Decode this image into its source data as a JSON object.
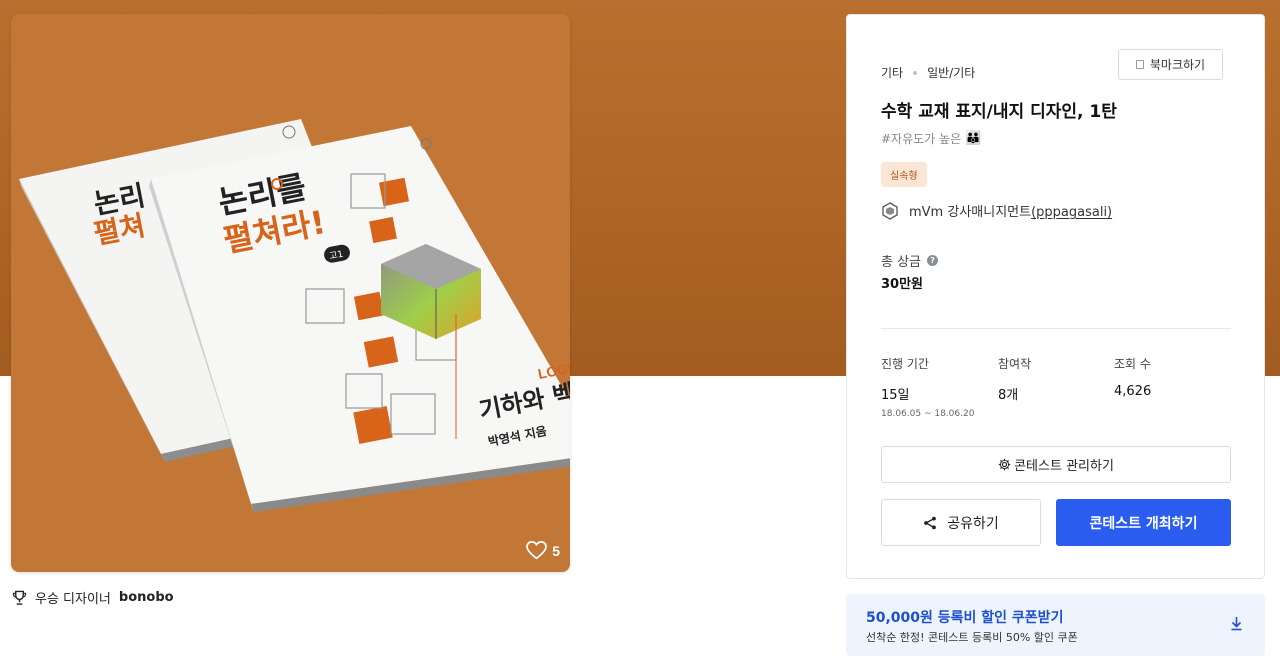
{
  "cover": {
    "like_count": "5",
    "book_front": {
      "title_line1": "논리를",
      "title_line2": "펼쳐라!",
      "grade_badge": "고1",
      "subject": "기하와 벡터",
      "series": "LOGIC",
      "author": "박영석 지음"
    },
    "book_back": {
      "title_line1": "논리",
      "title_line2": "펼쳐"
    }
  },
  "winner": {
    "label": "우승 디자이너",
    "name": "bonobo"
  },
  "panel": {
    "breadcrumb": [
      "기타",
      "일반/기타"
    ],
    "bookmark_label": "북마크하기",
    "title": "수학 교재 표지/내지 디자인, 1탄",
    "hashtag": "#자유도가 높은",
    "hashtag_emoji": "👪",
    "type_badge": "실속형",
    "host_name": "mVm 강사매니지먼트",
    "host_id": "(pppagasali)",
    "prize_label": "총 상금",
    "prize_value": "30만원",
    "stats": {
      "period_label": "진행 기간",
      "period_value": "15일",
      "period_dates": "18.06.05  ~  18.06.20",
      "entries_label": "참여작",
      "entries_value": "8개",
      "views_label": "조회 수",
      "views_value": "4,626"
    },
    "manage_label": "콘테스트 관리하기",
    "share_label": "공유하기",
    "host_contest_label": "콘테스트 개최하기"
  },
  "coupon": {
    "title": "50,000원 등록비 할인 쿠폰받기",
    "subtitle": "선착순 한정! 콘테스트 등록비 50% 할인 쿠폰"
  },
  "colors": {
    "hero": "#b06828",
    "primary_button": "#2a5cf0",
    "coupon_text": "#1f4fcc",
    "badge_bg": "#fbe6d6"
  }
}
